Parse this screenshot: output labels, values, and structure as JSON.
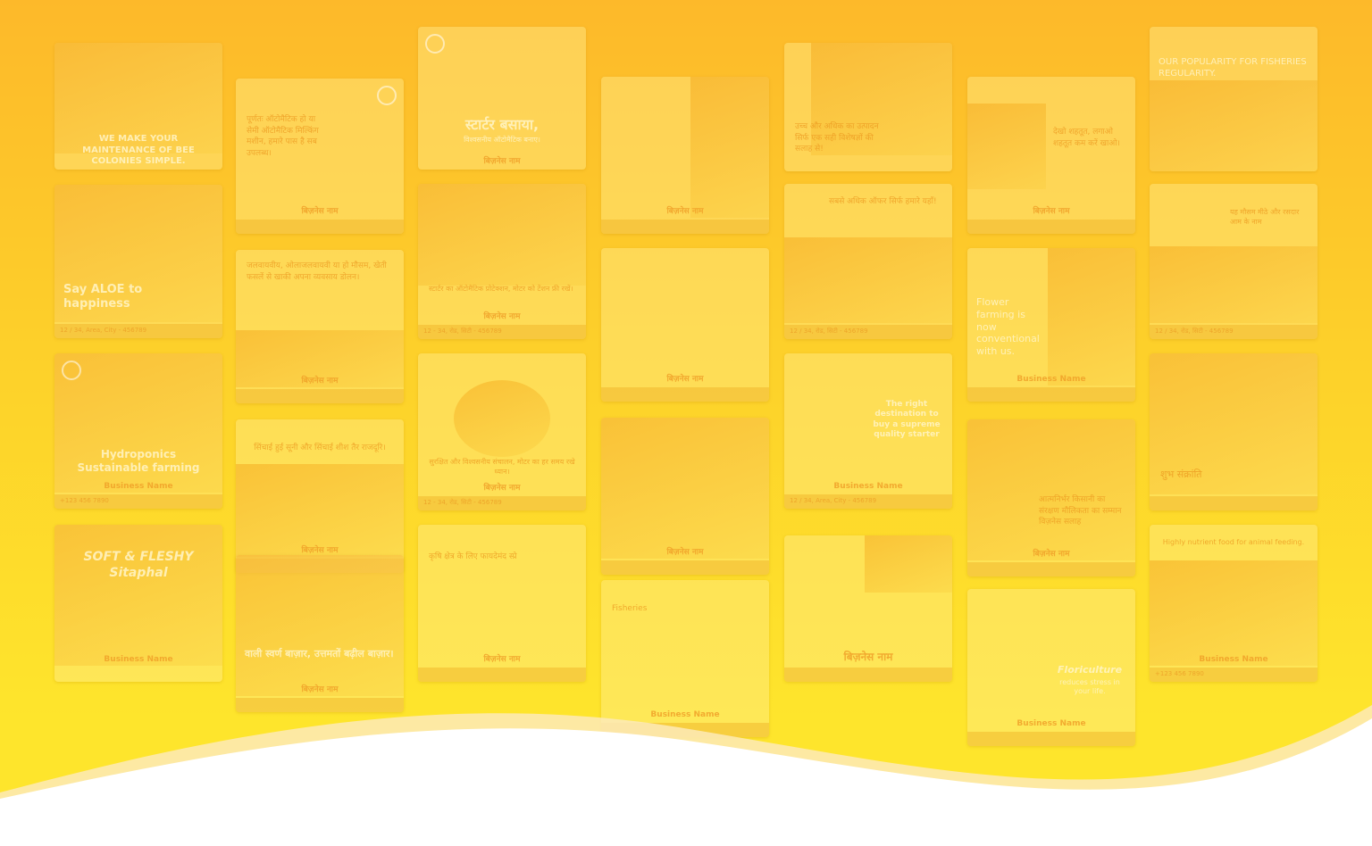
{
  "background": {
    "gradient_top": "#fdb92a",
    "gradient_bottom": "#fee52c",
    "wave_color": "#ffffff",
    "wave_shadow": "#fdeab8"
  },
  "cards": {
    "c1": {
      "headline": "WE MAKE YOUR MAINTENANCE OF BEE COLONIES SIMPLE."
    },
    "c2": {
      "headline": "Say ALOE to happiness",
      "footer": "12 / 34, Area, City - 456789"
    },
    "c3": {
      "headline": "Hydroponics Sustainable farming",
      "name": "Business Name",
      "footer": "+123 456 7890"
    },
    "c4": {
      "headline": "SOFT & FLESHY Sitaphal",
      "name": "Business Name"
    },
    "c5": {
      "body": "पूर्णतः ऑटोमैटिक हो या सेमी ऑटोमैटिक मिल्किंग मशीन, हमारे पास है सब उपलब्ध।",
      "name": "बिज़नेस नाम"
    },
    "c6": {
      "body": "जलवायवीय, ओलाजलवायवी या हो मौसम, खेती फसलें से खाकी अपना व्यवसाय डोलन।",
      "name": "बिज़नेस नाम"
    },
    "c7": {
      "body": "सिंचाई हुई सूनी और सिंचाई शीश तैर राजदूरि।",
      "name": "बिज़नेस नाम"
    },
    "c8": {
      "body": "वाली स्वर्ण बाज़ार, उत्तमतों बढ़ील बाज़ार।",
      "name": "बिज़नेस नाम"
    },
    "c9": {
      "headline": "स्टार्टर बसाया,",
      "sub": "विश्वसनीय ऑटोमैटिक बनाए।",
      "name": "बिज़नेस नाम"
    },
    "c10": {
      "body": "स्टार्टर का ऑटोमैटिक प्रोटेक्शन, मोटर को टेंशन फ्री रखें।",
      "name": "बिज़नेस नाम",
      "footer": "12 - 34, रोड, सिटी - 456789"
    },
    "c11": {
      "body": "सुरक्षित और विश्वसनीय संचालन, मोटर का हर समय रखे ध्यान।",
      "name": "बिज़नेस नाम",
      "footer": "12 - 34, रोड, सिटी - 456789"
    },
    "c12": {
      "body": "कृषि क्षेत्र के लिए फायदेमंद स्प्रे",
      "name": "बिज़नेस नाम"
    },
    "c13": {
      "name": "बिज़नेस नाम"
    },
    "c14": {
      "name": "बिज़नेस नाम"
    },
    "c15": {
      "name": "बिज़नेस नाम"
    },
    "c16": {
      "body": "Fisheries",
      "name": "Business Name"
    },
    "c17": {
      "body": "उच्च और अधिक का उत्पादन सिर्फ एक सही विशेषज्ञों की सलाह से!"
    },
    "c18": {
      "body": "सबसे अधिक ऑफर सिर्फ हमारे यहाँ!",
      "footer": "12 / 34, रोड, सिटी - 456789"
    },
    "c19": {
      "headline": "The right destination to buy a supreme quality starter",
      "name": "Business Name",
      "footer": "12 / 34, Area, City - 456789"
    },
    "c20": {
      "name": "बिज़नेस नाम"
    },
    "c21": {
      "body": "देखो शहतूत, लगाओ शहतूत कम करें खाओ।",
      "name": "बिज़नेस नाम"
    },
    "c22": {
      "headline": "Flower farming is now conventional with us.",
      "name": "Business Name"
    },
    "c23": {
      "body": "आत्मनिर्भर किसानी का संरक्षण मौलिकता का सम्मान विज़नेस सलाह",
      "name": "बिज़नेस नाम"
    },
    "c24": {
      "headline": "Floriculture",
      "sub": "reduces stress in your life.",
      "name": "Business Name"
    },
    "c25": {
      "headline": "OUR POPULARITY FOR FISHERIES REGULARITY."
    },
    "c26": {
      "body": "यह मौसम मीठे और रसदार आम के नाम",
      "footer": "12 / 34, रोड, सिटी - 456789"
    },
    "c27": {
      "body": "शुभ संक्रांति"
    },
    "c28": {
      "body": "Highly nutrient food for animal feeding.",
      "name": "Business Name",
      "footer": "+123 456 7890"
    }
  }
}
